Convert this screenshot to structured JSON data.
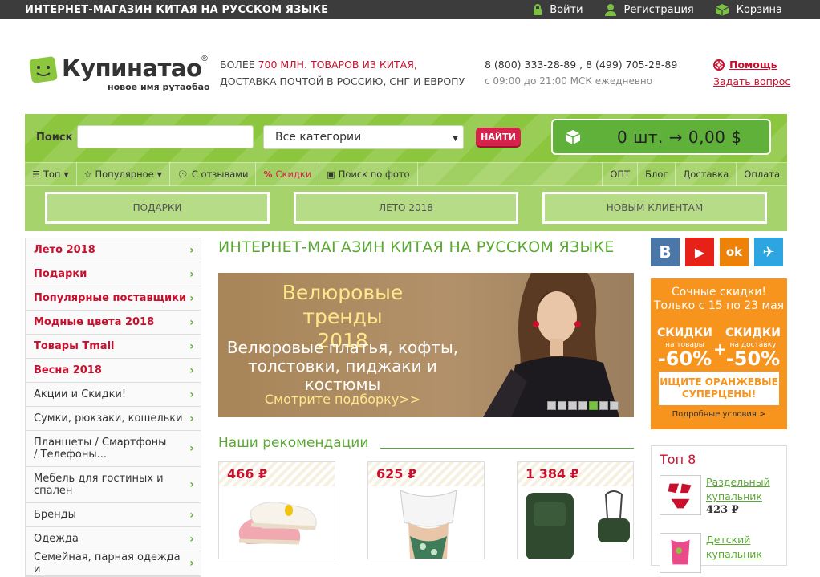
{
  "topbar": {
    "title": "ИНТЕРНЕТ-МАГАЗИН КИТАЯ НА РУССКОМ ЯЗЫКЕ",
    "login": "Войти",
    "register": "Регистрация",
    "cart": "Корзина"
  },
  "header": {
    "logo_name": "Купинатао",
    "logo_reg": "®",
    "logo_slogan": "новое имя рутаобао",
    "line1_prefix": "БОЛЕЕ ",
    "line1_red": "700 МЛН. ТОВАРОВ ИЗ КИТАЯ,",
    "line2": "ДОСТАВКА ПОЧТОЙ В РОССИЮ, СНГ И ЕВРОПУ",
    "phones": "8 (800) 333-28-89 , 8 (499) 705-28-89",
    "hours": "с 09:00 до 21:00 МСК ежедневно",
    "help": "Помощь",
    "ask": "Задать вопрос"
  },
  "search": {
    "label": "Поиск",
    "value": "",
    "placeholder": "",
    "category": "Все категории",
    "button": "НАЙТИ",
    "cart_summary": "0 шт. → 0,00 $"
  },
  "nav": {
    "left": [
      {
        "label": "Топ",
        "icon": "menu-icon"
      },
      {
        "label": "Популярное",
        "icon": "star-icon"
      },
      {
        "label": "С отзывами",
        "icon": "comment-icon"
      },
      {
        "label": "Скидки",
        "icon": "percent-icon"
      },
      {
        "label": "Поиск по фото",
        "icon": "photo-icon"
      }
    ],
    "right": [
      "ОПТ",
      "Блог",
      "Доставка",
      "Оплата"
    ]
  },
  "promos": [
    "ПОДАРКИ",
    "ЛЕТО 2018",
    "НОВЫМ КЛИЕНТАМ"
  ],
  "sidebar": {
    "items": [
      "Лето 2018",
      "Подарки",
      "Популярные поставщики",
      "Модные цвета 2018",
      "Товары Tmall",
      "Весна 2018",
      "Акции и Скидки!",
      "Сумки, рюкзаки, кошельки",
      "Планшеты / Смартфоны / Телефоны...",
      "Мебель для гостиных и спален",
      "Бренды",
      "Одежда",
      "Семейная, парная одежда и"
    ]
  },
  "main": {
    "title": "ИНТЕРНЕТ-МАГАЗИН КИТАЯ НА РУССКОМ ЯЗЫКЕ",
    "banner": {
      "h1": "Велюровые тренды 2018",
      "sub": "Велюровые платья, кофты, толстовки, пиджаки и костюмы",
      "link": "Смотрите подборку>>"
    },
    "rec_title": "Наши рекомендации",
    "products": [
      {
        "price": "466 ₽"
      },
      {
        "price": "625 ₽"
      },
      {
        "price": "1 384 ₽"
      }
    ]
  },
  "right": {
    "social": [
      "В",
      "▶",
      "ok",
      "✈"
    ],
    "ad": {
      "title": "Сочные скидки! Только с 15 по 23 мая",
      "col1_head": "СКИДКИ",
      "col1_small": "на товары",
      "col1_pct": "-60%",
      "col2_head": "СКИДКИ",
      "col2_small": "на доставку",
      "col2_pct": "-50%",
      "plus": "+",
      "box": "ИЩИТЕ ОРАНЖЕВЫЕ СУПЕРЦЕНЫ!",
      "cond": "Подробные условия >"
    },
    "top8": {
      "title": "Топ 8",
      "items": [
        {
          "name": "Раздельный купальник",
          "price": "423 ₽"
        },
        {
          "name": "Детский купальник",
          "price": ""
        }
      ]
    }
  },
  "colors": {
    "accent_green": "#8cc63f",
    "brand_red": "#c8102e",
    "orange": "#f7941d",
    "vk": "#4a76a8",
    "youtube": "#e62117",
    "ok": "#ee8208",
    "telegram": "#2ca5e0"
  }
}
